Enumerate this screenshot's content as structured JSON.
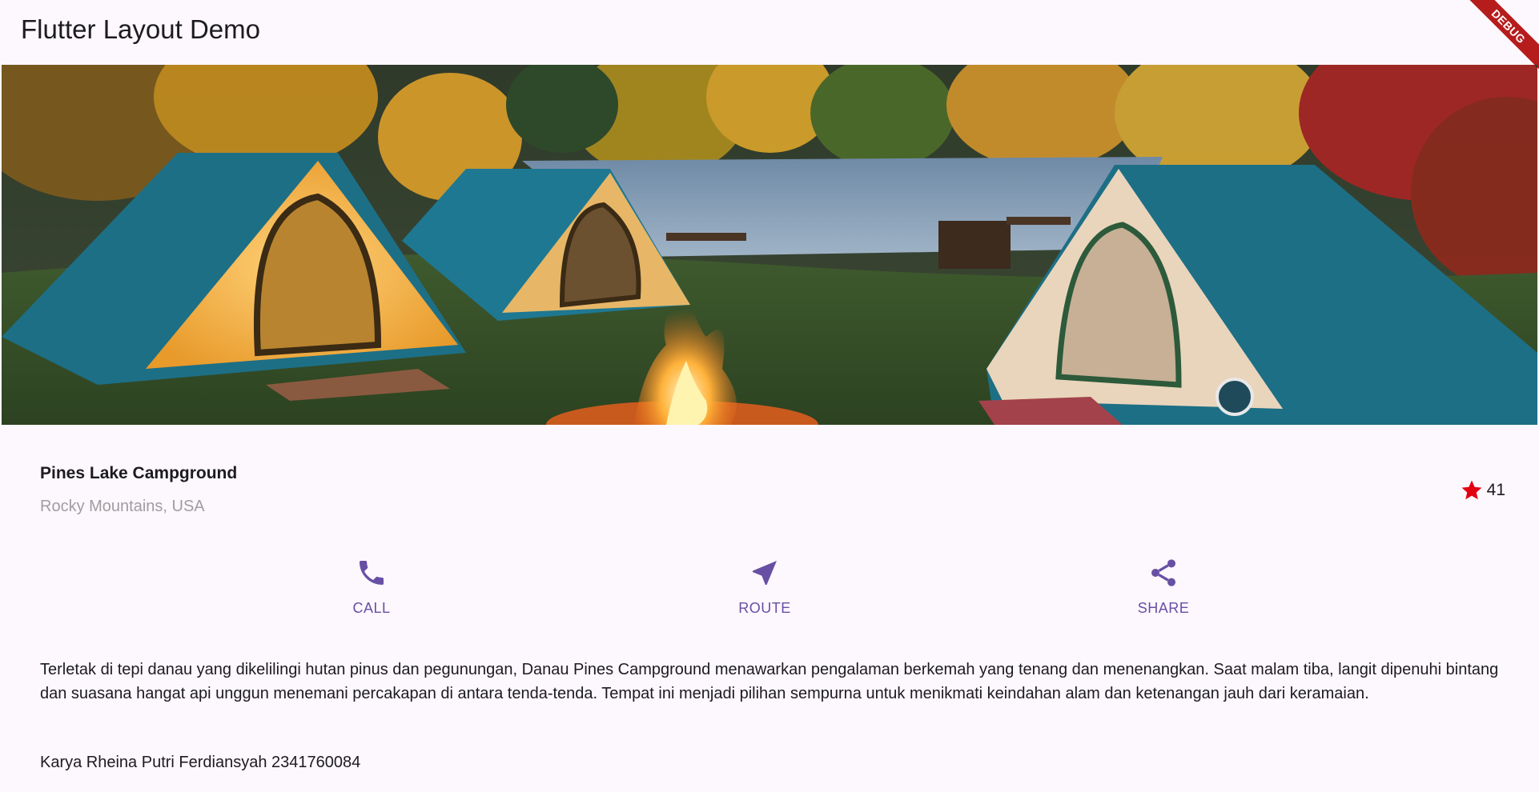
{
  "appbar": {
    "title": "Flutter Layout Demo",
    "debug_label": "DEBUG"
  },
  "hero": {
    "icon": "campground-photo"
  },
  "place": {
    "name": "Pines Lake Campground",
    "location": "Rocky Mountains, USA",
    "rating_count": "41",
    "star_color": "#e3000f"
  },
  "actions": {
    "accent_color": "#6750a4",
    "call": {
      "label": "CALL",
      "icon": "phone-icon"
    },
    "route": {
      "label": "ROUTE",
      "icon": "navigation-icon"
    },
    "share": {
      "label": "SHARE",
      "icon": "share-icon"
    }
  },
  "description": "Terletak di tepi danau yang dikelilingi hutan pinus dan pegunungan, Danau Pines Campground menawarkan pengalaman berkemah yang tenang dan menenangkan. Saat malam tiba, langit dipenuhi bintang dan suasana hangat api unggun menemani percakapan di antara tenda-tenda. Tempat ini menjadi pilihan sempurna untuk menikmati keindahan alam dan ketenangan jauh dari keramaian.",
  "author": "Karya Rheina Putri Ferdiansyah 2341760084"
}
